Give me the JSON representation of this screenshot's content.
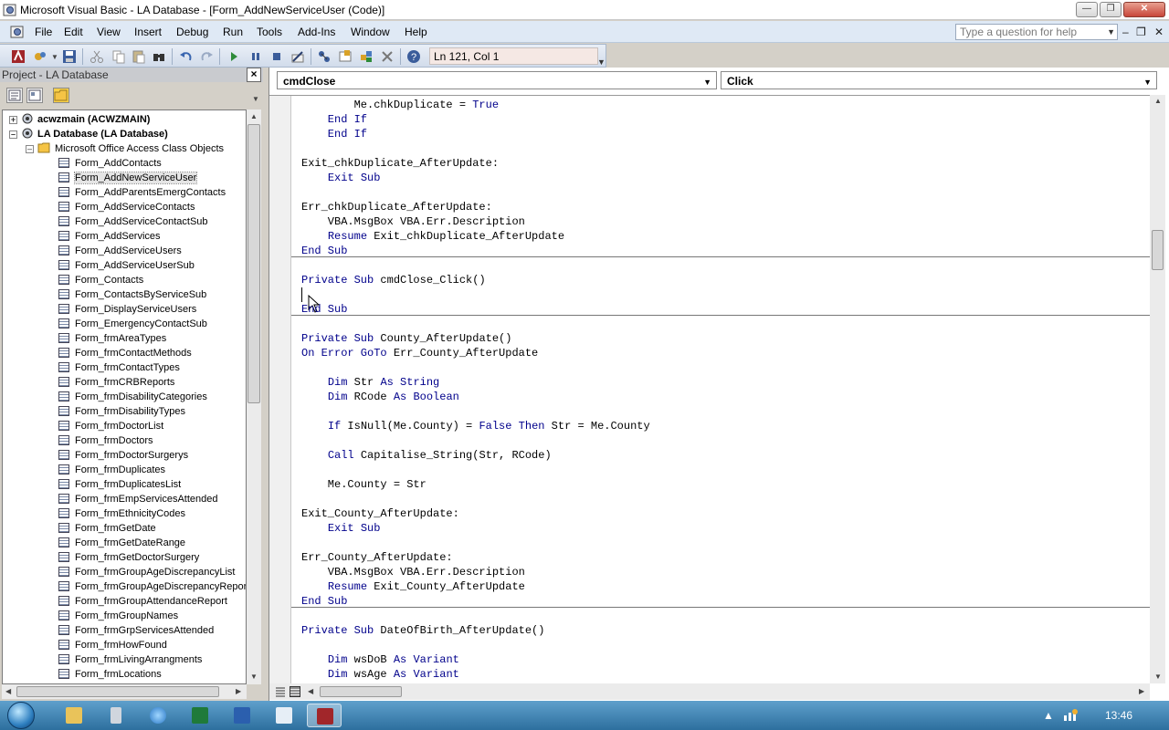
{
  "window": {
    "title": "Microsoft Visual Basic - LA Database - [Form_AddNewServiceUser (Code)]"
  },
  "menu": {
    "items": [
      "File",
      "Edit",
      "View",
      "Insert",
      "Debug",
      "Run",
      "Tools",
      "Add-Ins",
      "Window",
      "Help"
    ],
    "help_placeholder": "Type a question for help"
  },
  "toolbar": {
    "position": "Ln 121, Col 1"
  },
  "project": {
    "title": "Project - LA Database",
    "tree": {
      "root1": "acwzmain (ACWZMAIN)",
      "root2": "LA Database (LA Database)",
      "folder": "Microsoft Office Access Class Objects",
      "items": [
        "Form_AddContacts",
        "Form_AddNewServiceUser",
        "Form_AddParentsEmergContacts",
        "Form_AddServiceContacts",
        "Form_AddServiceContactSub",
        "Form_AddServices",
        "Form_AddServiceUsers",
        "Form_AddServiceUserSub",
        "Form_Contacts",
        "Form_ContactsByServiceSub",
        "Form_DisplayServiceUsers",
        "Form_EmergencyContactSub",
        "Form_frmAreaTypes",
        "Form_frmContactMethods",
        "Form_frmContactTypes",
        "Form_frmCRBReports",
        "Form_frmDisabilityCategories",
        "Form_frmDisabilityTypes",
        "Form_frmDoctorList",
        "Form_frmDoctors",
        "Form_frmDoctorSurgerys",
        "Form_frmDuplicates",
        "Form_frmDuplicatesList",
        "Form_frmEmpServicesAttended",
        "Form_frmEthnicityCodes",
        "Form_frmGetDate",
        "Form_frmGetDateRange",
        "Form_frmGetDoctorSurgery",
        "Form_frmGroupAgeDiscrepancyList",
        "Form_frmGroupAgeDiscrepancyReport",
        "Form_frmGroupAttendanceReport",
        "Form_frmGroupNames",
        "Form_frmGrpServicesAttended",
        "Form_frmHowFound",
        "Form_frmLivingArrangments",
        "Form_frmLocations"
      ]
    }
  },
  "code": {
    "object_combo": "cmdClose",
    "procedure_combo": "Click",
    "lines": [
      [
        {
          "t": "        Me.chkDuplicate = ",
          "c": "n"
        },
        {
          "t": "True",
          "c": "k"
        }
      ],
      [
        {
          "t": "    End If",
          "c": "k"
        }
      ],
      [
        {
          "t": "End If",
          "c": "k",
          "pre": "    "
        }
      ],
      [],
      [
        {
          "t": "Exit_chkDuplicate_AfterUpdate:",
          "c": "n"
        }
      ],
      [
        {
          "t": "    ",
          "c": "n"
        },
        {
          "t": "Exit Sub",
          "c": "k"
        }
      ],
      [],
      [
        {
          "t": "Err_chkDuplicate_AfterUpdate:",
          "c": "n"
        }
      ],
      [
        {
          "t": "    VBA.MsgBox VBA.Err.Description",
          "c": "n"
        }
      ],
      [
        {
          "t": "    ",
          "c": "n"
        },
        {
          "t": "Resume",
          "c": "k"
        },
        {
          "t": " Exit_chkDuplicate_AfterUpdate",
          "c": "n"
        }
      ],
      [
        {
          "t": "End Sub",
          "c": "k"
        }
      ],
      [],
      [
        {
          "t": "Private Sub",
          "c": "k"
        },
        {
          "t": " cmdClose_Click()",
          "c": "n"
        }
      ],
      [],
      [
        {
          "t": "End Sub",
          "c": "k"
        }
      ],
      [],
      [
        {
          "t": "Private Sub",
          "c": "k"
        },
        {
          "t": " County_AfterUpdate()",
          "c": "n"
        }
      ],
      [
        {
          "t": "On Error GoTo",
          "c": "k"
        },
        {
          "t": " Err_County_AfterUpdate",
          "c": "n"
        }
      ],
      [],
      [
        {
          "t": "    ",
          "c": "n"
        },
        {
          "t": "Dim",
          "c": "k"
        },
        {
          "t": " Str ",
          "c": "n"
        },
        {
          "t": "As String",
          "c": "k"
        }
      ],
      [
        {
          "t": "    ",
          "c": "n"
        },
        {
          "t": "Dim",
          "c": "k"
        },
        {
          "t": " RCode ",
          "c": "n"
        },
        {
          "t": "As Boolean",
          "c": "k"
        }
      ],
      [],
      [
        {
          "t": "    ",
          "c": "n"
        },
        {
          "t": "If",
          "c": "k"
        },
        {
          "t": " IsNull(Me.County) = ",
          "c": "n"
        },
        {
          "t": "False Then",
          "c": "k"
        },
        {
          "t": " Str = Me.County",
          "c": "n"
        }
      ],
      [],
      [
        {
          "t": "    ",
          "c": "n"
        },
        {
          "t": "Call",
          "c": "k"
        },
        {
          "t": " Capitalise_String(Str, RCode)",
          "c": "n"
        }
      ],
      [],
      [
        {
          "t": "    Me.County = Str",
          "c": "n"
        }
      ],
      [],
      [
        {
          "t": "Exit_County_AfterUpdate:",
          "c": "n"
        }
      ],
      [
        {
          "t": "    ",
          "c": "n"
        },
        {
          "t": "Exit Sub",
          "c": "k"
        }
      ],
      [],
      [
        {
          "t": "Err_County_AfterUpdate:",
          "c": "n"
        }
      ],
      [
        {
          "t": "    VBA.MsgBox VBA.Err.Description",
          "c": "n"
        }
      ],
      [
        {
          "t": "    ",
          "c": "n"
        },
        {
          "t": "Resume",
          "c": "k"
        },
        {
          "t": " Exit_County_AfterUpdate",
          "c": "n"
        }
      ],
      [
        {
          "t": "End Sub",
          "c": "k"
        }
      ],
      [],
      [
        {
          "t": "Private Sub",
          "c": "k"
        },
        {
          "t": " DateOfBirth_AfterUpdate()",
          "c": "n"
        }
      ],
      [],
      [
        {
          "t": "    ",
          "c": "n"
        },
        {
          "t": "Dim",
          "c": "k"
        },
        {
          "t": " wsDoB ",
          "c": "n"
        },
        {
          "t": "As Variant",
          "c": "k"
        }
      ],
      [
        {
          "t": "    ",
          "c": "n"
        },
        {
          "t": "Dim",
          "c": "k"
        },
        {
          "t": " wsAge ",
          "c": "n"
        },
        {
          "t": "As Variant",
          "c": "k"
        }
      ]
    ]
  },
  "taskbar": {
    "clock": "13:46"
  },
  "colors": {
    "keyword": "#00008b",
    "normal": "#000000"
  }
}
